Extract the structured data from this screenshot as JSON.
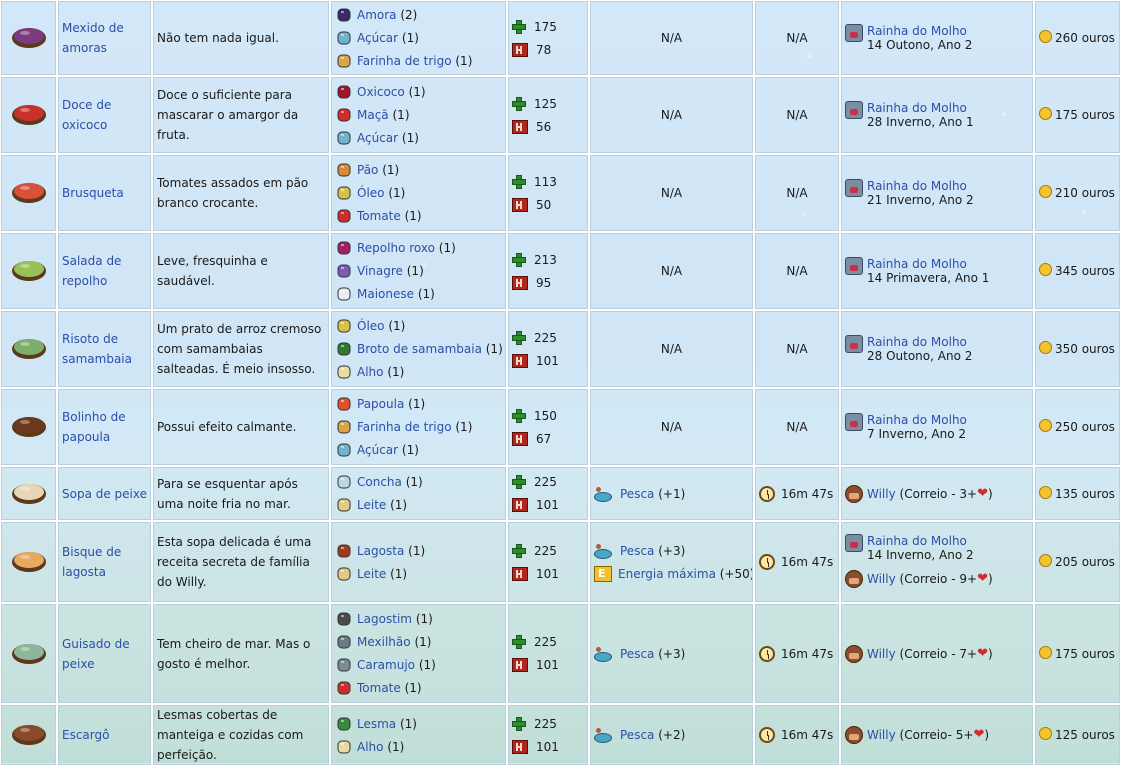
{
  "currency_suffix": "ouros",
  "rows": [
    {
      "name": "Mexido de amoras",
      "desc": "Não tem nada igual.",
      "icon": "blackberry-cobbler-icon",
      "food_color": "#7b3b7e",
      "ingredients": [
        {
          "n": "Amora",
          "q": "(2)",
          "c": "#3b2a6b"
        },
        {
          "n": "Açúcar",
          "q": "(1)",
          "c": "#6fb3cf"
        },
        {
          "n": "Farinha de trigo",
          "q": "(1)",
          "c": "#d7a64a"
        }
      ],
      "energy": "175",
      "health": "78",
      "buff": "N/A",
      "duration": "N/A",
      "source": {
        "who": "Rainha do Molho",
        "when": "14 Outono, Ano 2"
      },
      "price": "260 ouros"
    },
    {
      "name": "Doce de oxicoco",
      "desc": "Doce o suficiente para mascarar o amargor da fruta.",
      "icon": "cranberry-candy-icon",
      "food_color": "#c9302c",
      "ingredients": [
        {
          "n": "Oxicoco",
          "q": "(1)",
          "c": "#a3142a"
        },
        {
          "n": "Maçã",
          "q": "(1)",
          "c": "#d12b2b"
        },
        {
          "n": "Açúcar",
          "q": "(1)",
          "c": "#6fb3cf"
        }
      ],
      "energy": "125",
      "health": "56",
      "buff": "N/A",
      "duration": "N/A",
      "source": {
        "who": "Rainha do Molho",
        "when": "28 Inverno, Ano 1"
      },
      "price": "175 ouros"
    },
    {
      "name": "Brusqueta",
      "desc": "Tomates assados em pão branco crocante.",
      "icon": "bruschetta-icon",
      "food_color": "#d8503a",
      "ingredients": [
        {
          "n": "Pão",
          "q": "(1)",
          "c": "#d78a3a"
        },
        {
          "n": "Óleo",
          "q": "(1)",
          "c": "#d6c24a"
        },
        {
          "n": "Tomate",
          "q": "(1)",
          "c": "#d12b2b"
        }
      ],
      "energy": "113",
      "health": "50",
      "buff": "N/A",
      "duration": "N/A",
      "source": {
        "who": "Rainha do Molho",
        "when": "21 Inverno, Ano 2"
      },
      "price": "210 ouros"
    },
    {
      "name": "Salada de repolho",
      "desc": "Leve, fresquinha e saudável.",
      "icon": "coleslaw-icon",
      "food_color": "#9ac05a",
      "ingredients": [
        {
          "n": "Repolho roxo",
          "q": "(1)",
          "c": "#a0206e"
        },
        {
          "n": "Vinagre",
          "q": "(1)",
          "c": "#7a5bb5"
        },
        {
          "n": "Maionese",
          "q": "(1)",
          "c": "#e9eef4"
        }
      ],
      "energy": "213",
      "health": "95",
      "buff": "N/A",
      "duration": "N/A",
      "source": {
        "who": "Rainha do Molho",
        "when": "14 Primavera, Ano 1"
      },
      "price": "345 ouros"
    },
    {
      "name": "Risoto de samambaia",
      "desc": "Um prato de arroz cremoso com samambaias salteadas. É meio insosso.",
      "icon": "fiddlehead-risotto-icon",
      "food_color": "#7fae6a",
      "ingredients": [
        {
          "n": "Óleo",
          "q": "(1)",
          "c": "#d6c24a"
        },
        {
          "n": "Broto de samambaia",
          "q": "(1)",
          "c": "#2e7a2e"
        },
        {
          "n": "Alho",
          "q": "(1)",
          "c": "#e9dca0"
        }
      ],
      "energy": "225",
      "health": "101",
      "buff": "N/A",
      "duration": "N/A",
      "source": {
        "who": "Rainha do Molho",
        "when": "28 Outono, Ano 2"
      },
      "price": "350 ouros"
    },
    {
      "name": "Bolinho de papoula",
      "desc": "Possui efeito calmante.",
      "icon": "poppyseed-muffin-icon",
      "food_color": "#6b3a1c",
      "ingredients": [
        {
          "n": "Papoula",
          "q": "(1)",
          "c": "#e0502a"
        },
        {
          "n": "Farinha de trigo",
          "q": "(1)",
          "c": "#d7a64a"
        },
        {
          "n": "Açúcar",
          "q": "(1)",
          "c": "#6fb3cf"
        }
      ],
      "energy": "150",
      "health": "67",
      "buff": "N/A",
      "duration": "N/A",
      "source": {
        "who": "Rainha do Molho",
        "when": "7 Inverno, Ano 2"
      },
      "price": "250 ouros"
    },
    {
      "name": "Sopa de peixe",
      "desc": "Para se esquentar após uma noite fria no mar.",
      "icon": "chowder-icon",
      "food_color": "#e8d7b5",
      "ingredients": [
        {
          "n": "Concha",
          "q": "(1)",
          "c": "#b8d8e6"
        },
        {
          "n": "Leite",
          "q": "(1)",
          "c": "#e2c985"
        }
      ],
      "energy": "225",
      "health": "101",
      "buffs": [
        {
          "t": "Pesca",
          "v": "(+1)",
          "i": "fishing-icon"
        }
      ],
      "duration": "16m 47s",
      "sources": [
        {
          "type": "willy",
          "who": "Willy",
          "note": "(Correio - 3+",
          "heart": "❤",
          ")": ")"
        }
      ],
      "price": "135 ouros"
    },
    {
      "name": "Bisque de lagosta",
      "desc": "Esta sopa delicada é uma receita secreta de família do Willy.",
      "icon": "lobster-bisque-icon",
      "food_color": "#e6a960",
      "ingredients": [
        {
          "n": "Lagosta",
          "q": "(1)",
          "c": "#a13a20"
        },
        {
          "n": "Leite",
          "q": "(1)",
          "c": "#e2c985"
        }
      ],
      "energy": "225",
      "health": "101",
      "buffs": [
        {
          "t": "Pesca",
          "v": "(+3)",
          "i": "fishing-icon"
        },
        {
          "t": "Energia máxima",
          "v": "(+50)",
          "i": "max-energy-icon"
        }
      ],
      "duration": "16m 47s",
      "sources": [
        {
          "type": "queen",
          "who": "Rainha do Molho",
          "when": "14 Inverno, Ano 2"
        },
        {
          "type": "willy",
          "who": "Willy",
          "note": "(Correio - 9+",
          "heart": "❤",
          ")": ")"
        }
      ],
      "price": "205 ouros"
    },
    {
      "name": "Guisado de peixe",
      "desc": "Tem cheiro de mar. Mas o gosto é melhor.",
      "icon": "fish-stew-icon",
      "food_color": "#8fb59a",
      "ingredients": [
        {
          "n": "Lagostim",
          "q": "(1)",
          "c": "#4a4a4a"
        },
        {
          "n": "Mexilhão",
          "q": "(1)",
          "c": "#6b7a88"
        },
        {
          "n": "Caramujo",
          "q": "(1)",
          "c": "#7a8a90"
        },
        {
          "n": "Tomate",
          "q": "(1)",
          "c": "#d12b2b"
        }
      ],
      "energy": "225",
      "health": "101",
      "buffs": [
        {
          "t": "Pesca",
          "v": "(+3)",
          "i": "fishing-icon"
        }
      ],
      "duration": "16m 47s",
      "sources": [
        {
          "type": "willy",
          "who": "Willy",
          "note": "(Correio - 7+",
          "heart": "❤",
          ")": ")"
        }
      ],
      "price": "175 ouros"
    },
    {
      "name": "Escargô",
      "desc": "Lesmas cobertas de manteiga e cozidas com perfeição.",
      "icon": "escargot-icon",
      "food_color": "#8a4a2a",
      "ingredients": [
        {
          "n": "Lesma",
          "q": "(1)",
          "c": "#3b8a3b"
        },
        {
          "n": "Alho",
          "q": "(1)",
          "c": "#e9dca0"
        }
      ],
      "energy": "225",
      "health": "101",
      "buffs": [
        {
          "t": "Pesca",
          "v": "(+2)",
          "i": "fishing-icon"
        }
      ],
      "duration": "16m 47s",
      "sources": [
        {
          "type": "willy",
          "who": "Willy",
          "note": "(Correio- 5+",
          "heart": "❤",
          ")": ")"
        }
      ],
      "price": "125 ouros"
    }
  ]
}
